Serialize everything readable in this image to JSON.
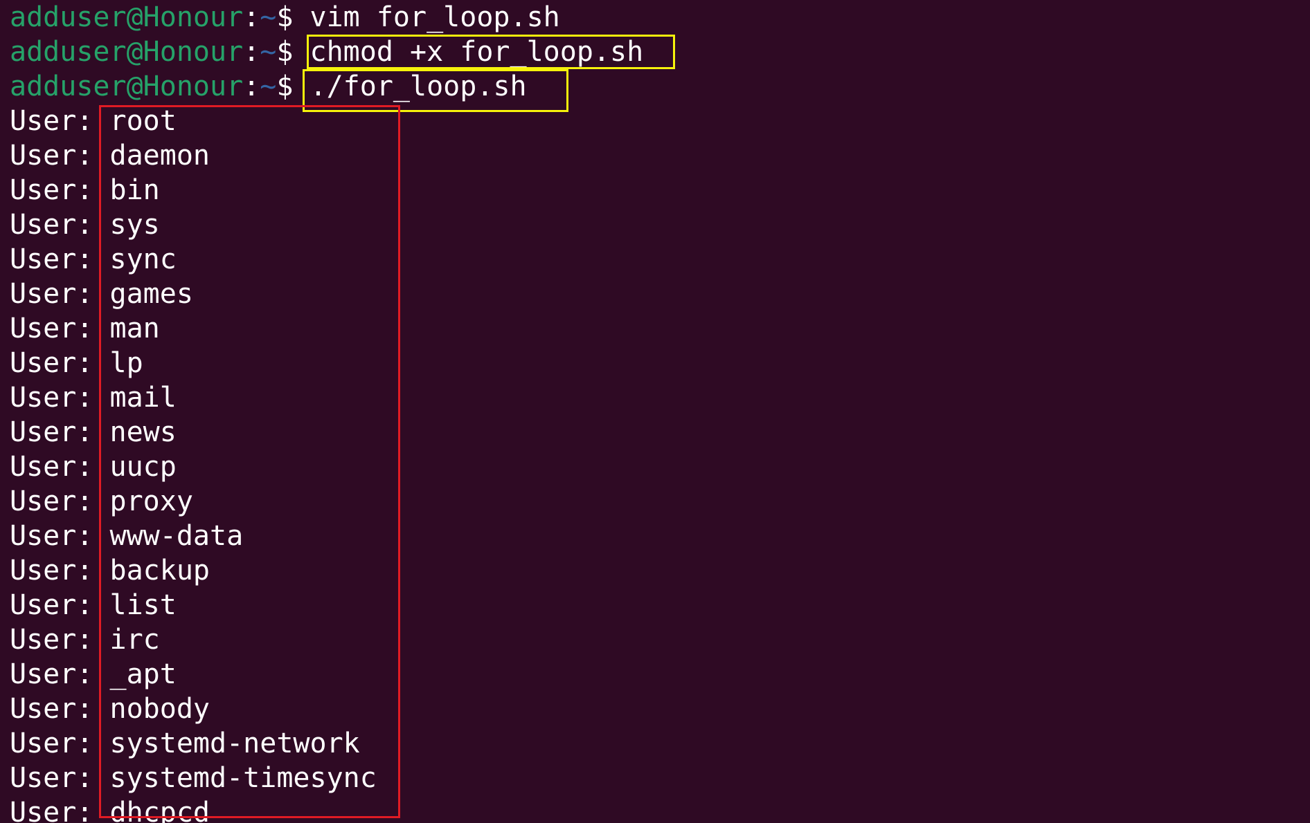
{
  "terminal": {
    "prompt": {
      "user_host": "adduser@Honour",
      "colon": ":",
      "path": "~",
      "symbol": "$ "
    },
    "commands": [
      "vim for_loop.sh",
      "chmod +x for_loop.sh",
      "./for_loop.sh"
    ],
    "output_prefix": "User: ",
    "output_users": [
      "root",
      "daemon",
      "bin",
      "sys",
      "sync",
      "games",
      "man",
      "lp",
      "mail",
      "news",
      "uucp",
      "proxy",
      "www-data",
      "backup",
      "list",
      "irc",
      "_apt",
      "nobody",
      "systemd-network",
      "systemd-timesync",
      "dhcpcd"
    ]
  },
  "colors": {
    "background": "#2f0a24",
    "prompt_user": "#26a269",
    "prompt_path": "#3465a4",
    "text": "#ffffff",
    "highlight_command": "#f6f20b",
    "highlight_output": "#e01b24"
  }
}
